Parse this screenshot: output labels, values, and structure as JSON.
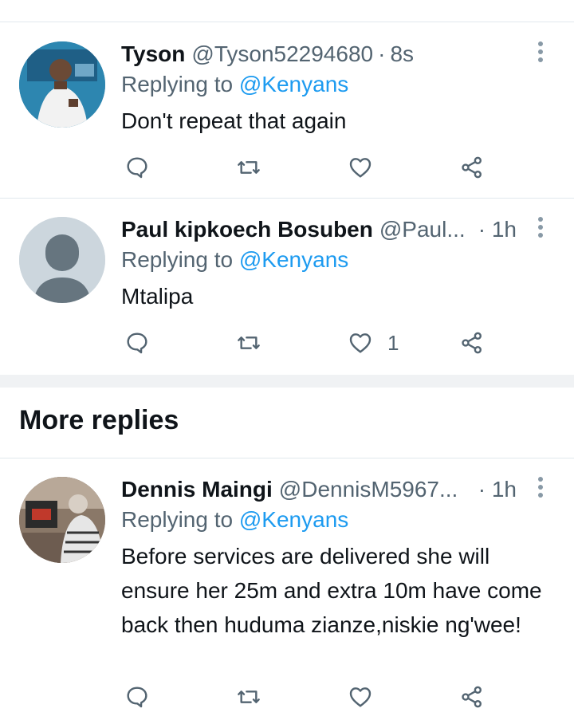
{
  "tweets": [
    {
      "name": "Tyson",
      "handle": "@Tyson52294680",
      "time": "8s",
      "replying_prefix": "Replying to ",
      "replying_to": "@Kenyans",
      "text": "Don't repeat that again",
      "likes": ""
    },
    {
      "name": "Paul kipkoech Bosuben",
      "handle": "@Paul...",
      "time": "· 1h",
      "replying_prefix": "Replying to ",
      "replying_to": "@Kenyans",
      "text": "Mtalipa",
      "likes": "1"
    },
    {
      "name": "Dennis Maingi",
      "handle": "@DennisM5967...",
      "time": "· 1h",
      "replying_prefix": "Replying to ",
      "replying_to": "@Kenyans",
      "text": "Before services are delivered she will ensure her 25m and extra 10m have come back then huduma zianze,niskie ng'wee!",
      "likes": ""
    }
  ],
  "section": {
    "title": "More replies"
  },
  "icons": {
    "reply": "reply-icon",
    "retweet": "retweet-icon",
    "like": "heart-icon",
    "share": "share-icon",
    "more": "more-options-icon"
  },
  "colors": {
    "accent": "#1d9bf0",
    "muted": "#536471",
    "icon": "#536471"
  }
}
